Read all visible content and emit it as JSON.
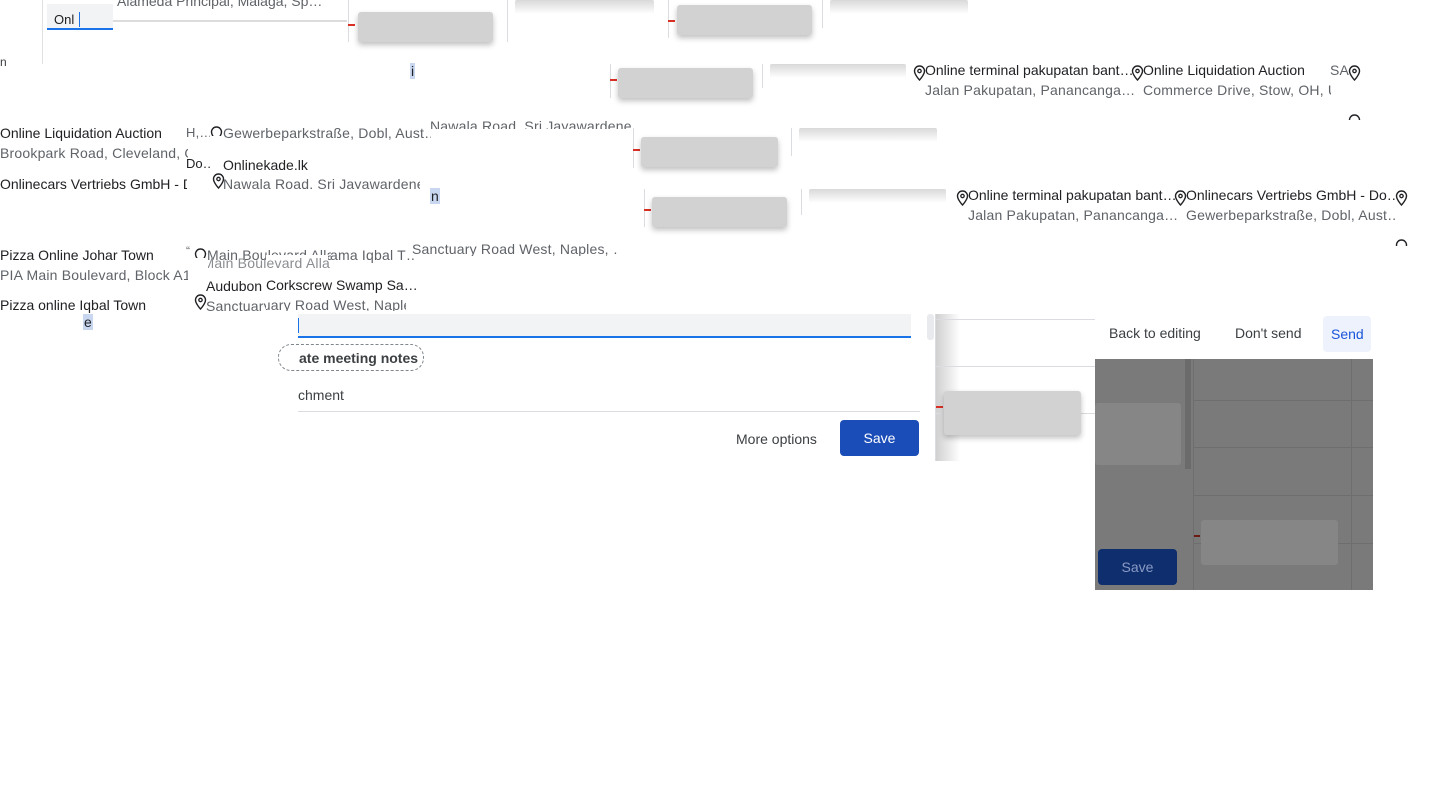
{
  "top_popup": {
    "partial_address": "Alameda Principal, Málaga, Sp…",
    "query": "Onl"
  },
  "row1": {
    "sel_char": "i",
    "s1": {
      "title": "Online terminal pakupatan bant…",
      "address": "Jalan Pakupatan, Panancanga…"
    },
    "s2": {
      "title": "Online Liquidation Auction",
      "address": "Commerce Drive, Stow, OH, U"
    },
    "s3_partial": "SA"
  },
  "row2": {
    "left_title": "Online Liquidation Auction",
    "left_address": "Brookpark Road, Cleveland, O",
    "frag_oh": "H,…",
    "addr_gewerbe": "Gewerbeparkstraße, Dobl, Aust…",
    "addr_nawala_top": "Nawala Road, Sri Jayawardene…",
    "frag_do": "Do…",
    "onlinekade_title": "Onlinekade.lk",
    "onlinekade_address": "Nawala Road, Sri Jayawardene",
    "onlinecars_left": "Onlinecars Vertriebs GmbH - D"
  },
  "row3": {
    "sel_char": "n",
    "s1": {
      "title": "Online terminal pakupatan bant…",
      "address": "Jalan Pakupatan, Panancanga…"
    },
    "s2": {
      "title": "Onlinecars Vertriebs GmbH - Do…",
      "address": "Gewerbeparkstraße, Dobl, Aust…"
    }
  },
  "row4": {
    "pizza_johar_title": "Pizza Online Johar Town",
    "pizza_johar_address": "PIA Main Boulevard, Block A1",
    "frag_main_boulevard": "Main Boulevard Alla",
    "frag_allama": "ama Iqbal T…",
    "frag_sanctuary": "Sanctuary Road West, Naples, …",
    "audubon_title": "Audubon",
    "corkscrew": "Corkscrew Swamp Sa…",
    "pizza_iqbal_title": "Pizza online Iqbal Town",
    "frag_sanct2": "Sanctuary Road West, Naples",
    "typed_char": "e"
  },
  "editor": {
    "meeting_notes_chip": "ate meeting notes",
    "attachment_label": "chment",
    "more_options": "More options",
    "save": "Save"
  },
  "send_dialog": {
    "back_to_editing": "Back to editing",
    "dont_send": "Don't send",
    "send": "Send",
    "bg_save": "Save"
  },
  "colors": {
    "primary": "#1b4db8",
    "caret": "#1a73e8",
    "error_tick": "#d93025",
    "overlay": "#7a7a7a"
  },
  "icons": [
    "location-pin-icon"
  ]
}
